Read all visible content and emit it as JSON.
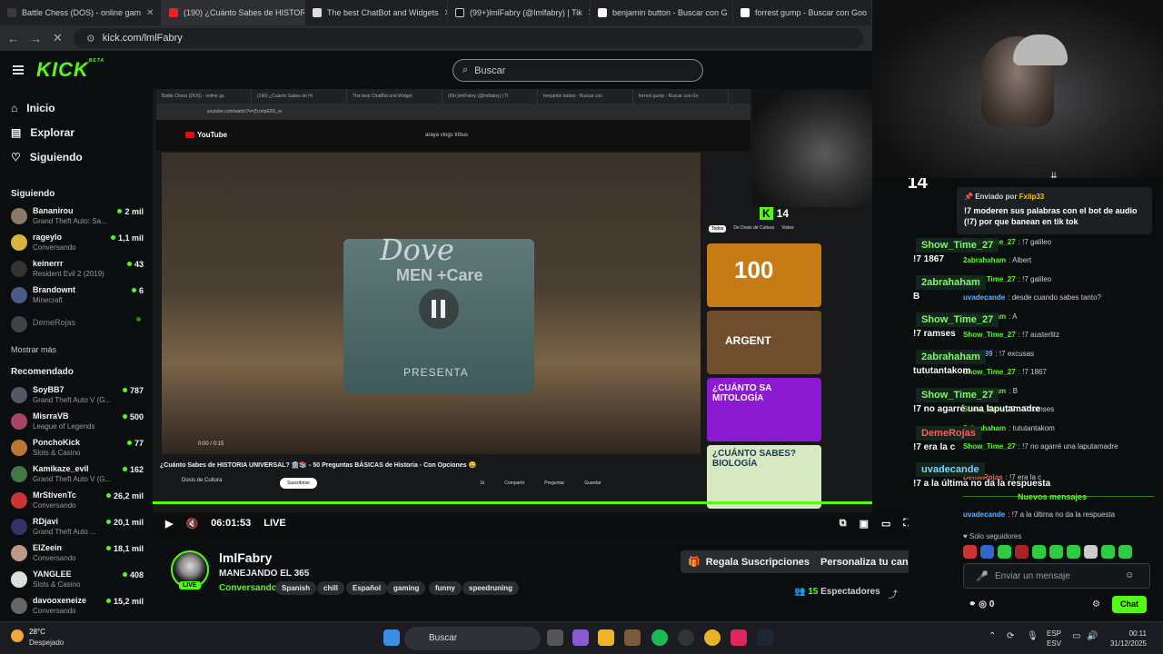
{
  "browser": {
    "tabs": [
      {
        "label": "Battle Chess (DOS) - online gam"
      },
      {
        "label": "(190) ¿Cuánto Sabes de HISTORI"
      },
      {
        "label": "The best ChatBot and Widgets"
      },
      {
        "label": "(99+)lmlFabry (@lmlfabry) | Tik"
      },
      {
        "label": "benjamin button - Buscar con G"
      },
      {
        "label": "forrest gump - Buscar con Goo"
      }
    ],
    "url": "kick.com/lmlFabry"
  },
  "header": {
    "logo": "KICK",
    "logo_sup": "BETA",
    "search_placeholder": "Buscar"
  },
  "sidebar": {
    "nav": [
      {
        "label": "Inicio",
        "icon": "home-icon"
      },
      {
        "label": "Explorar",
        "icon": "explore-icon"
      },
      {
        "label": "Siguiendo",
        "icon": "heart-icon"
      }
    ],
    "following_title": "Siguiendo",
    "following": [
      {
        "name": "Bananirou",
        "category": "Grand Theft Auto: Sa...",
        "viewers": "2 mil"
      },
      {
        "name": "rageylo",
        "category": "Conversando",
        "viewers": "1,1 mil"
      },
      {
        "name": "keinerrr",
        "category": "Resident Evil 2 (2019)",
        "viewers": "43"
      },
      {
        "name": "Brandownt",
        "category": "Minecraft",
        "viewers": "6"
      },
      {
        "name": "DemeRojas",
        "category": "",
        "viewers": ""
      }
    ],
    "show_more": "Mostrar más",
    "recommended_title": "Recomendado",
    "recommended": [
      {
        "name": "SoyBB7",
        "category": "Grand Theft Auto V (G...",
        "viewers": "787"
      },
      {
        "name": "MisrraVB",
        "category": "League of Legends",
        "viewers": "500"
      },
      {
        "name": "PonchoKick",
        "category": "Slots & Casino",
        "viewers": "77"
      },
      {
        "name": "Kamikaze_evil",
        "category": "Grand Theft Auto V (G...",
        "viewers": "162"
      },
      {
        "name": "MrStivenTc",
        "category": "Conversando",
        "viewers": "26,2 mil"
      },
      {
        "name": "RDjavi",
        "category": "Grand Theft Auto ...",
        "viewers": "20,1 mil"
      },
      {
        "name": "ElZeein",
        "category": "Conversando",
        "viewers": "18,1 mil"
      },
      {
        "name": "YANGLEE",
        "category": "Slots & Casino",
        "viewers": "408"
      },
      {
        "name": "davooxeneize",
        "category": "Conversando",
        "viewers": "15,2 mil"
      }
    ]
  },
  "video": {
    "inner_tabs": [
      "Battle Chess (DOS) - online ga",
      "(190) ¿Cuánto Sabes de Hi",
      "The best ChatBot and Widget",
      "(99+)lmlFabry (@lmlfabry) | Ti",
      "benjamin button - Buscar con",
      "forrest gump - Buscar con Go"
    ],
    "inner_url": "youtube.com/watch?v=ZLmIpE9G_w",
    "yt_logo": "YouTube",
    "yt_query": "araya vlogs tribus",
    "ad_brand": "Dove",
    "ad_line": "MEN +Care",
    "ad_presenta": "PRESENTA",
    "yt_time": "0:00 / 0:15",
    "yt_title": "¿Cuánto Sabes de HISTORIA UNIVERSAL? 🏛️📚 - 50 Preguntas BÁSICAS de Historia - Con Opciones 😀",
    "yt_channel": "Dosis de Cultura",
    "yt_subscribe": "Suscribirse",
    "yt_likes": "1k",
    "yt_share": "Compartir",
    "yt_ask": "Preguntar",
    "yt_save": "Guardar",
    "yt_filters": [
      "Todos",
      "De Dosis de Cultura",
      "Vistos"
    ],
    "thumbs": [
      {
        "label": "100",
        "color": "#c77b14"
      },
      {
        "label": "ARGENT",
        "color": "#6e4e2c"
      },
      {
        "label": "¿CUÁNTO SA MITOLOGÍA",
        "color": "#8c1ad0"
      },
      {
        "label": "¿CUÁNTO SABES? BIOLOGÍA",
        "color": "#d8e8c0"
      }
    ],
    "kick_viewers_badge": "14",
    "elapsed": "06:01:53",
    "live": "LIVE"
  },
  "channel": {
    "name": "lmlFabry",
    "title": "MANEJANDO EL 365",
    "category": "Conversando",
    "live": "LIVE",
    "tags": [
      "Spanish",
      "chill",
      "Español",
      "gaming",
      "funny",
      "speedruning"
    ],
    "gift_button": "Regala Suscripciones",
    "customize_button": "Personaliza tu canal",
    "viewers_count": "15",
    "viewers_label": "Espectadores"
  },
  "overlay": {
    "kick_count": "14",
    "tts": [
      {
        "name": "Show_Time_27",
        "text": "!7 1867",
        "color": "#7dfc62"
      },
      {
        "name": "2abrahaham",
        "text": "B",
        "color": "#7dfc62"
      },
      {
        "name": "Show_Time_27",
        "text": "!7 ramses",
        "color": "#7dfc62"
      },
      {
        "name": "2abrahaham",
        "text": "tututantakom",
        "color": "#7dfc62"
      },
      {
        "name": "Show_Time_27",
        "text": "!7 no agarré una laputamadre",
        "color": "#7dfc62"
      },
      {
        "name": "DemeRojas",
        "text": "!7 era la c",
        "color": "#ff5a5a"
      },
      {
        "name": "uvadecande",
        "text": "!7 a la última no da la respuesta",
        "color": "#7dd3ff"
      }
    ]
  },
  "chat": {
    "pinned_by_label": "Enviado por",
    "pinned_user": "Fxlip33",
    "pinned_message": "!7 moderen sus palabras con el bot de audio (!7) por que banean en tik tok",
    "messages": [
      {
        "user": "Show_Time_27",
        "text": "!7 galileo",
        "color": "#53fc18"
      },
      {
        "user": "2abrahaham",
        "text": "Albert",
        "color": "#53fc18"
      },
      {
        "user": "Show_Time_27",
        "text": "!7 galileo",
        "color": "#53fc18"
      },
      {
        "user": "uvadecande",
        "text": "desde cuando sabes tanto?",
        "color": "#5ab4ff"
      },
      {
        "user": "2abrahaham",
        "text": "A",
        "color": "#53fc18"
      },
      {
        "user": "Show_Time_27",
        "text": "!7 austerlitz",
        "color": "#53fc18"
      },
      {
        "user": "bauti839",
        "text": "!7 excusas",
        "color": "#5ab4ff"
      },
      {
        "user": "Show_Time_27",
        "text": "!7 1867",
        "color": "#53fc18"
      },
      {
        "user": "2abrahaham",
        "text": "B",
        "color": "#53fc18"
      },
      {
        "user": "Show_Time_27",
        "text": "!7 ramses",
        "color": "#53fc18"
      },
      {
        "user": "2abrahaham",
        "text": "tututantakom",
        "color": "#53fc18"
      },
      {
        "user": "Show_Time_27",
        "text": "!7 no agarré una laputamadre",
        "color": "#53fc18"
      },
      {
        "user": "DemeRojas",
        "text": "!7 era la c",
        "color": "#ff5a5a"
      }
    ],
    "new_messages": "Nuevos mensajes",
    "last_message_user": "uvadecande",
    "last_message_text": "!7 a la última no da la respuesta",
    "followers_only": "Solo seguidores",
    "input_placeholder": "Enviar un mensaje",
    "points": "0",
    "chat_button": "Chat"
  },
  "taskbar": {
    "temp": "28°C",
    "weather": "Despejado",
    "search": "Buscar",
    "lang": "ESP",
    "lang2": "ESV",
    "time": "00:11",
    "date": "31/12/2025"
  }
}
